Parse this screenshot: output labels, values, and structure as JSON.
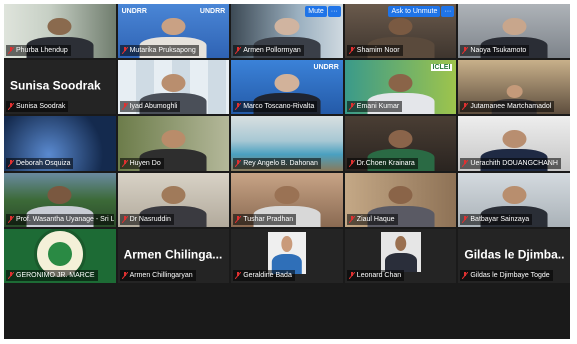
{
  "toolbar": {
    "mute_label": "Mute",
    "ask_unmute_label": "Ask to Unmute",
    "more_label": "···"
  },
  "tiles": [
    {
      "name": "Phurba Lhendup",
      "bg": "#7a8a78"
    },
    {
      "name": "Mutarika Pruksapong",
      "bg": "#3f74c4",
      "logo": "UNDRR"
    },
    {
      "name": "Armen Pollormyan",
      "bg": "#6d7e8c"
    },
    {
      "name": "Shamim Noor",
      "bg": "#5a5048"
    },
    {
      "name": "Naoya Tsukamoto",
      "bg": "#8b8f96"
    },
    {
      "name": "Sunisa Soodrak",
      "bigname": "Sunisa Soodrak",
      "bg": "#242424"
    },
    {
      "name": "Iyad Abumoghli",
      "bg": "#d9e3ea"
    },
    {
      "name": "Marco Toscano-Rivalta",
      "bg": "#2f6fc0",
      "logo": "UNDRR"
    },
    {
      "name": "Emani Kumar",
      "bg": "#8fb24a",
      "logo": "ICLEI"
    },
    {
      "name": "Jutamanee Martchamadol",
      "bg": "#8d7a64"
    },
    {
      "name": "Deborah Osquiza",
      "bg": "#2a4a78"
    },
    {
      "name": "Huyen Do",
      "bg": "#8d9a6b"
    },
    {
      "name": "Rey Angelo B. Dahonan",
      "bg": "#7aa5b8"
    },
    {
      "name": "Dr.Choen Krainara",
      "bg": "#5d5044"
    },
    {
      "name": "Uerachith DOUANGCHANH",
      "bg": "#d7d7d7"
    },
    {
      "name": "Prof. Wasantha Uyanage - Sri Lanka",
      "bg": "#3f6b3a"
    },
    {
      "name": "Dr Nasruddin",
      "bg": "#c9c2b5"
    },
    {
      "name": "Tushar Pradhan",
      "bg": "#b08d73"
    },
    {
      "name": "Ziaul Haque",
      "bg": "#a58b6e"
    },
    {
      "name": "Batbayar Sainzaya",
      "bg": "#c5ccd2"
    },
    {
      "name": "GERONIMO JR. MARCE",
      "bg": "#1d6b35",
      "logo": "seal"
    },
    {
      "name": "Armen Chillingaryan",
      "bigname": "Armen Chilinga...",
      "bg": "#242424"
    },
    {
      "name": "Geraldine Bada",
      "bg": "#efefef"
    },
    {
      "name": "Leonard Chan",
      "bg": "#242424"
    },
    {
      "name": "Gildas le Djimbaye Togde",
      "bigname": "Gildas le Djimba...",
      "bg": "#242424"
    }
  ],
  "colors": {
    "active_outline": "#d8e33a",
    "button": "#1f74e8",
    "muted_mic": "#e03030"
  }
}
